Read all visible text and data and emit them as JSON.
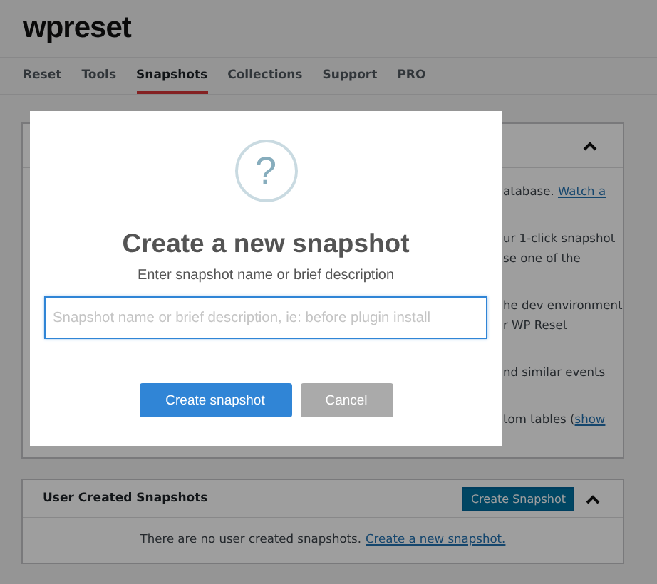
{
  "logo": "wpreset",
  "tabs": [
    {
      "label": "Reset",
      "selected": false
    },
    {
      "label": "Tools",
      "selected": false
    },
    {
      "label": "Snapshots",
      "selected": true
    },
    {
      "label": "Collections",
      "selected": false
    },
    {
      "label": "Support",
      "selected": false
    },
    {
      "label": "PRO",
      "selected": false
    }
  ],
  "info_card": {
    "expanded": true,
    "lines": [
      {
        "text": "atabase. ",
        "link": "Watch a"
      },
      {
        "text": "ur 1-click snapshot"
      },
      {
        "text": "se one of the"
      },
      {
        "text": "he dev environment"
      },
      {
        "text": "r WP Reset"
      },
      {
        "text": "nd similar events"
      },
      {
        "text": "tom tables (",
        "link": "show"
      }
    ]
  },
  "snapshots_card": {
    "title": "User Created Snapshots",
    "button": "Create Snapshot",
    "expanded": true,
    "empty_text": "There are no user created snapshots.",
    "empty_link": "Create a new snapshot."
  },
  "dialog": {
    "icon": "?",
    "title": "Create a new snapshot",
    "subtitle": "Enter snapshot name or brief description",
    "input": {
      "placeholder": "Snapshot name or brief description, ie: before plugin install"
    },
    "buttons": [
      {
        "label": "Create snapshot",
        "kind": "confirm"
      },
      {
        "label": "Cancel",
        "kind": "cancel"
      }
    ]
  }
}
